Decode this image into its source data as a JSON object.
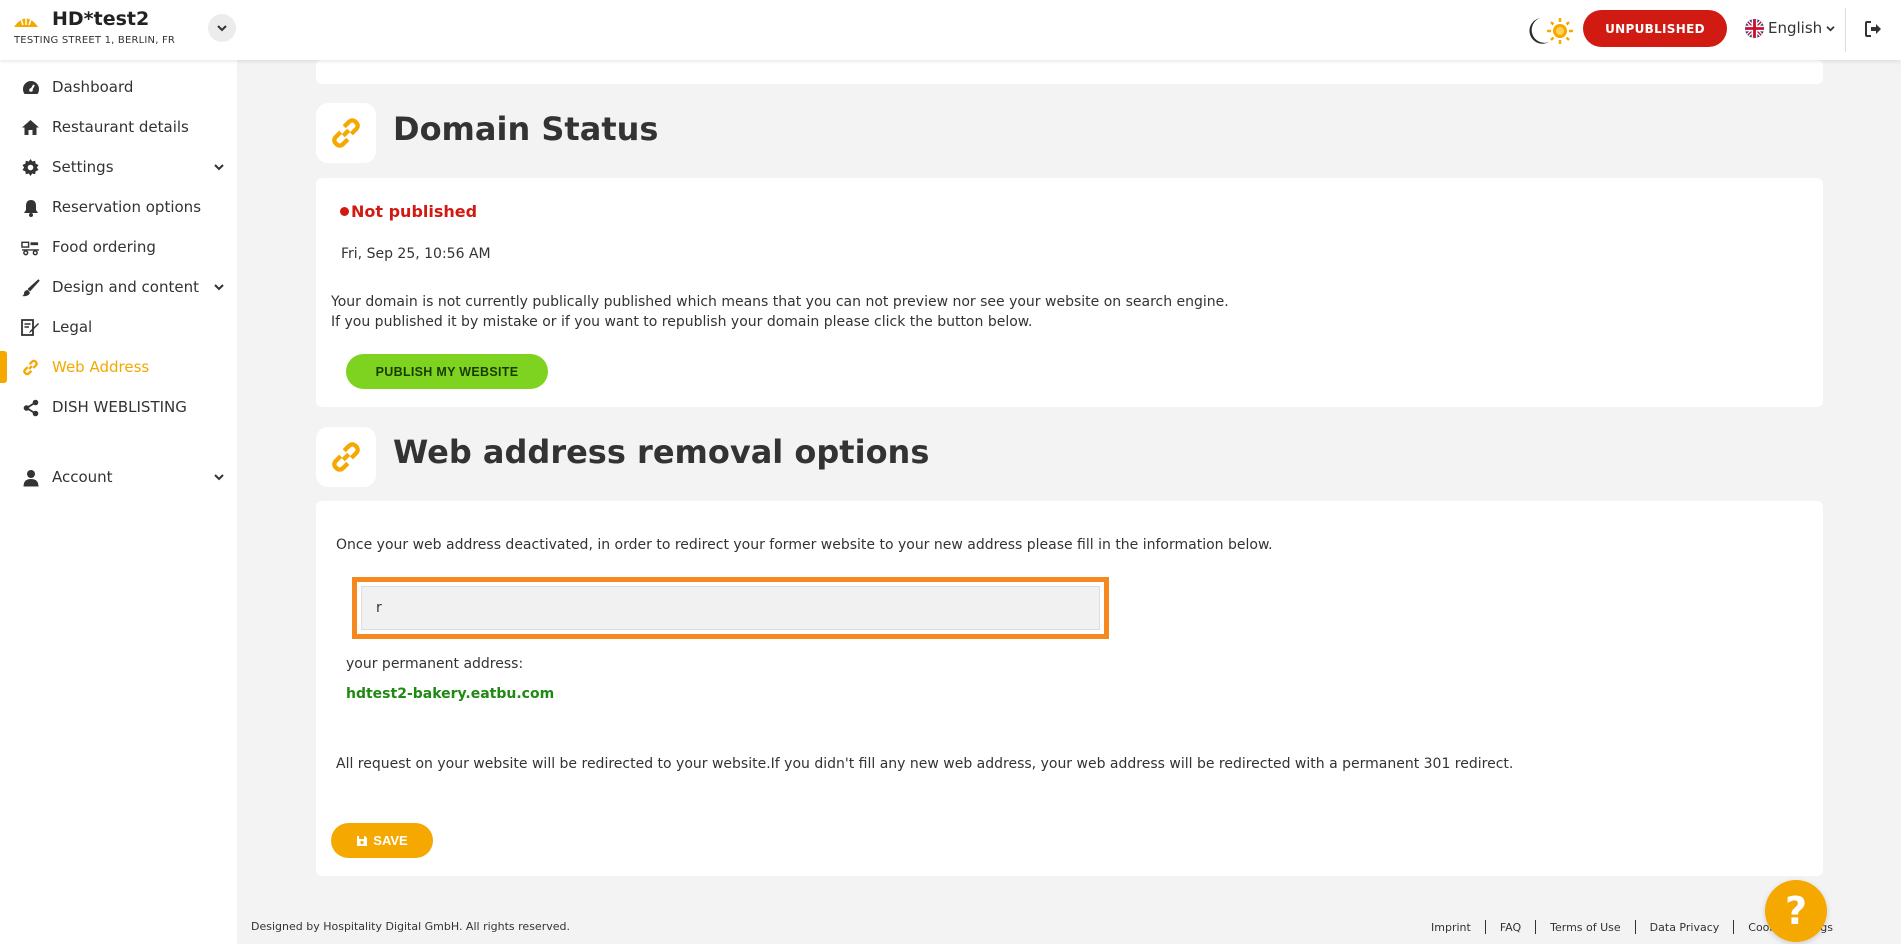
{
  "header": {
    "restaurant_name": "HD*test2",
    "restaurant_address": "TESTING STREET 1, BERLIN, FR",
    "status_badge": "UNPUBLISHED",
    "language": "English",
    "theme_icon": "moon-sun-icon",
    "logout_icon": "logout-icon"
  },
  "sidebar": {
    "items": [
      {
        "label": "Dashboard",
        "icon": "dashboard-icon"
      },
      {
        "label": "Restaurant details",
        "icon": "home-icon"
      },
      {
        "label": "Settings",
        "icon": "gear-icon"
      },
      {
        "label": "Reservation options",
        "icon": "bell-icon"
      },
      {
        "label": "Food ordering",
        "icon": "food-ordering-icon"
      },
      {
        "label": "Design and content",
        "icon": "brush-icon"
      },
      {
        "label": "Legal",
        "icon": "legal-icon"
      },
      {
        "label": "Web Address",
        "icon": "link-icon"
      },
      {
        "label": "DISH WEBLISTING",
        "icon": "share-icon"
      },
      {
        "label": "Account",
        "icon": "user-icon"
      }
    ],
    "active": "Web Address"
  },
  "domain_status": {
    "title": "Domain Status",
    "status": "Not published",
    "date": "Fri, Sep 25, 10:56 AM",
    "description_line1": "Your domain is not currently publically published which means that you can not preview nor see your website on search engine.",
    "description_line2": "If you published it by mistake or if you want to republish your domain please click the button below.",
    "publish_button": "PUBLISH MY WEBSITE"
  },
  "removal": {
    "title": "Web address removal options",
    "intro": "Once your web address deactivated, in order to redirect your former website to your new address please fill in the information below.",
    "input_value": "r",
    "permanent_label": "your permanent address:",
    "permanent_address": "hdtest2-bakery.eatbu.com",
    "redirect_note": "All request on your website will be redirected to your website.If you didn't fill any new web address, your web address will be redirected with a permanent 301 redirect.",
    "save_button": "SAVE"
  },
  "footer": {
    "copyright": "Designed by Hospitality Digital GmbH. All rights reserved.",
    "links": [
      "Imprint",
      "FAQ",
      "Terms of Use",
      "Data Privacy",
      "Cookie settings"
    ]
  },
  "colors": {
    "accent": "#f5a800",
    "danger": "#d11a12",
    "success": "#7ed321",
    "highlight": "#f5881f"
  }
}
